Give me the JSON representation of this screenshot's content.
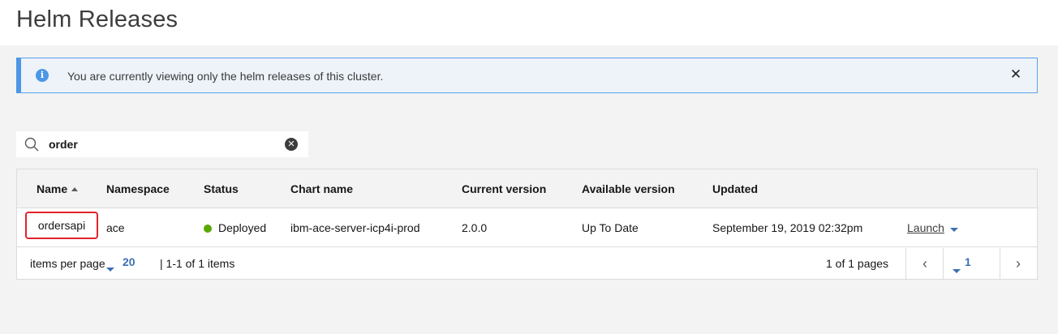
{
  "page": {
    "title": "Helm Releases"
  },
  "notification": {
    "text": "You are currently viewing only the helm releases of this cluster.",
    "info_icon": "i",
    "close_glyph": "✕"
  },
  "search": {
    "value": "order",
    "clear_glyph": "✕"
  },
  "table": {
    "columns": [
      "Name",
      "Namespace",
      "Status",
      "Chart name",
      "Current version",
      "Available version",
      "Updated"
    ],
    "sort": {
      "column": "Name",
      "direction": "ascending"
    },
    "rows": [
      {
        "name": "ordersapi",
        "namespace": "ace",
        "status": "Deployed",
        "chart_name": "ibm-ace-server-icp4i-prod",
        "current_version": "2.0.0",
        "available_version": "Up To Date",
        "updated": "September 19, 2019 02:32pm",
        "action": "Launch"
      }
    ]
  },
  "pagination": {
    "items_per_page_label": "items per page",
    "items_per_page": "20",
    "range": "| 1-1 of 1 items",
    "pages": "1 of 1 pages",
    "current_page": "1",
    "prev_glyph": "‹",
    "next_glyph": "›"
  },
  "colors": {
    "accent": "#3d70b2",
    "info": "#4e96e6",
    "status_deployed": "#5aa700",
    "highlight": "#e0242b"
  }
}
